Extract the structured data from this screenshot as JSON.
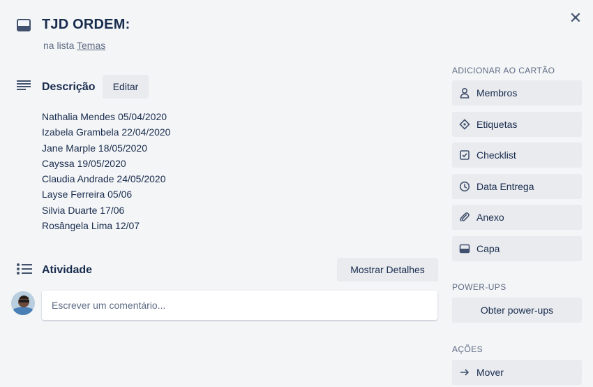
{
  "card": {
    "title": "TJD ORDEM:",
    "in_list_prefix": "na lista",
    "list_name": "Temas"
  },
  "description": {
    "heading": "Descrição",
    "edit_label": "Editar",
    "lines": [
      "Nathalia Mendes 05/04/2020",
      "Izabela Grambela 22/04/2020",
      "Jane Marple 18/05/2020",
      "Cayssa 19/05/2020",
      "Claudia Andrade 24/05/2020",
      "Layse Ferreira 05/06",
      "Silvia Duarte 17/06",
      "Rosângela Lima 12/07"
    ]
  },
  "activity": {
    "heading": "Atividade",
    "details_label": "Mostrar Detalhes",
    "comment_placeholder": "Escrever um comentário..."
  },
  "sidebar": {
    "add_heading": "ADICIONAR AO CARTÃO",
    "add_items": [
      {
        "label": "Membros",
        "icon": "person-icon"
      },
      {
        "label": "Etiquetas",
        "icon": "tag-icon"
      },
      {
        "label": "Checklist",
        "icon": "checklist-icon"
      },
      {
        "label": "Data Entrega",
        "icon": "clock-icon"
      },
      {
        "label": "Anexo",
        "icon": "paperclip-icon"
      },
      {
        "label": "Capa",
        "icon": "cover-icon"
      }
    ],
    "powerups_heading": "POWER-UPS",
    "powerups_label": "Obter power-ups",
    "actions_heading": "AÇÕES",
    "move_label": "Mover",
    "move_icon": "arrow-right-icon"
  },
  "colors": {
    "background": "#f4f5f7",
    "button": "#e9ebee",
    "text": "#172b4d",
    "muted": "#5e6c84"
  }
}
